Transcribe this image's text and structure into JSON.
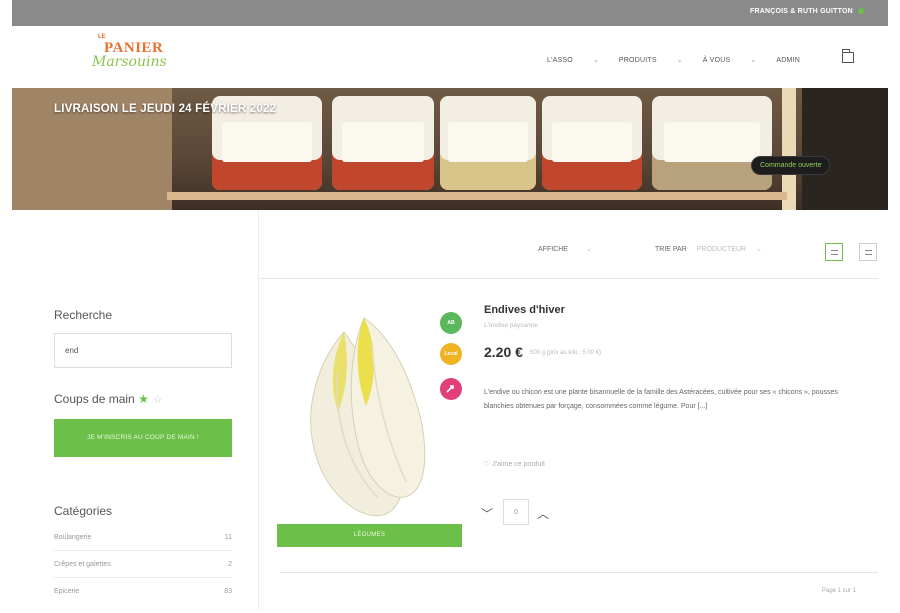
{
  "topbar": {
    "user_name": "FRANÇOIS & RUTH GUITTON"
  },
  "logo": {
    "le": "LE",
    "panier": "PANIER",
    "marsouins": "Marsouins"
  },
  "nav": {
    "items": [
      {
        "label": "L'ASSO"
      },
      {
        "label": "PRODUITS"
      },
      {
        "label": "À VOUS"
      },
      {
        "label": "ADMIN"
      }
    ]
  },
  "banner": {
    "title": "LIVRAISON LE JEUDI 24 FÉVRIER 2022",
    "order_status": "Commande ouverte"
  },
  "toolbar": {
    "display_label": "AFFICHE",
    "display_value": "",
    "sort_label": "TRIE PAR",
    "sort_value": "PRODUCTEUR"
  },
  "sidebar": {
    "search_title": "Recherche",
    "search_value": "end",
    "help_title": "Coups de main",
    "help_button": "JE M'INSCRIS AU COUP DE MAIN !",
    "categories_title": "Catégories",
    "categories": [
      {
        "name": "Boulangerie",
        "count": "11"
      },
      {
        "name": "Crêpes et galettes",
        "count": "2"
      },
      {
        "name": "Epicerie",
        "count": "83"
      }
    ]
  },
  "product": {
    "name": "Endives d'hiver",
    "producer": "L'endive paysanne",
    "price": "2.20 €",
    "unit": "500 g (prix au kilo : 5.00 €)",
    "description": "L'endive ou chicon est une plante bisannuelle de la famille des Astéracées, cultivée pour ses « chicons », pousses blanchies obtenues par forçage, consommées comme légume. Pour [...]",
    "like": "J'aime ce produit",
    "category_button": "LÉGUMES",
    "quantity": "0",
    "badges": [
      {
        "text": "AB",
        "color": "#5cb85c"
      },
      {
        "text": "Local",
        "color": "#f0b323"
      },
      {
        "text": "",
        "color": "#e23f7a"
      }
    ]
  },
  "pagination": {
    "label": "Page 1 sur 1"
  }
}
